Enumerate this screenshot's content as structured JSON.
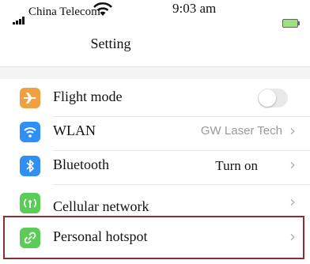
{
  "status_bar": {
    "carrier": "China Telecom",
    "time": "9:03 am"
  },
  "header": {
    "title": "Setting"
  },
  "settings": [
    {
      "label": "Flight mode",
      "icon": "airplane-icon",
      "color": "#f0a040",
      "toggle": false
    },
    {
      "label": "WLAN",
      "icon": "wifi-icon",
      "color": "#2f8ff5",
      "value": "GW Laser Tech"
    },
    {
      "label": "Bluetooth",
      "icon": "bluetooth-icon",
      "color": "#2f8ff5",
      "value": "Turn on"
    },
    {
      "label": "Cellular network",
      "icon": "cellular-icon",
      "color": "#5ccc58"
    },
    {
      "label": "Personal hotspot",
      "icon": "hotspot-icon",
      "color": "#5ccc58",
      "highlighted": true
    }
  ],
  "chevron": "›"
}
